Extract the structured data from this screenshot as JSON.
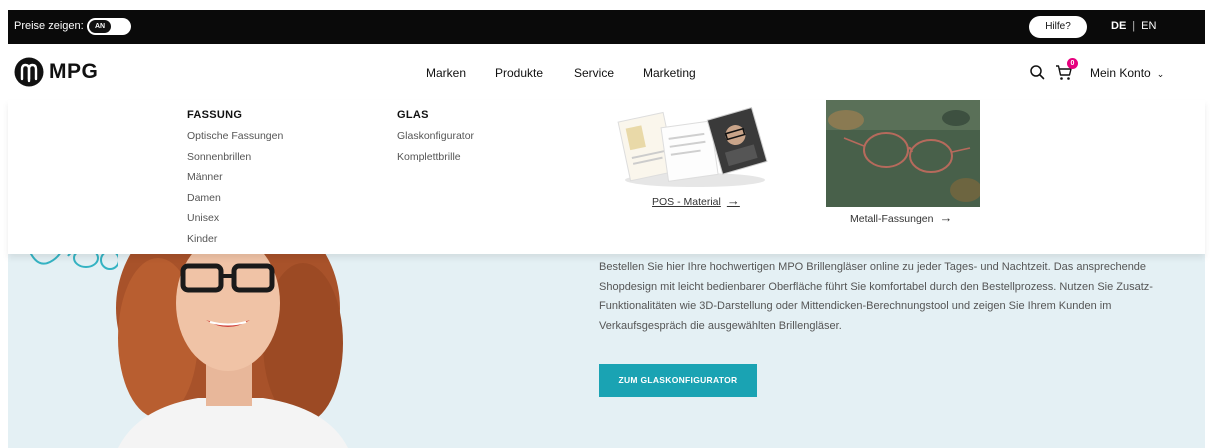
{
  "topbar": {
    "prices_label": "Preise zeigen:",
    "toggle_state": "AN",
    "help_label": "Hilfe?",
    "lang_active": "DE",
    "lang_separator": "|",
    "lang_other": "EN"
  },
  "header": {
    "logo_text": "MPG",
    "nav": [
      "Marken",
      "Produkte",
      "Service",
      "Marketing"
    ],
    "cart_count": "0",
    "account_label": "Mein Konto"
  },
  "megamenu": {
    "fassung": {
      "title": "FASSUNG",
      "items": [
        "Optische Fassungen",
        "Sonnenbrillen",
        "Männer",
        "Damen",
        "Unisex",
        "Kinder"
      ]
    },
    "glas": {
      "title": "GLAS",
      "items": [
        "Glaskonfigurator",
        "Komplettbrille"
      ]
    },
    "promos": {
      "pos_caption": "POS - Material",
      "metall_caption": "Metall-Fassungen",
      "arrow": "→"
    }
  },
  "hero": {
    "text": "Bestellen Sie hier Ihre hochwertigen MPO Brillengläser online zu jeder Tages- und Nachtzeit. Das ansprechende Shopdesign mit leicht bedienbarer Oberfläche führt Sie komfortabel durch den Bestellprozess. Nutzen Sie Zusatz-Funktionalitäten wie 3D-Darstellung oder Mittendicken-Berechnungstool und zeigen Sie Ihrem Kunden im Verkaufsgespräch die ausgewählten Brillengläser.",
    "cta_label": "ZUM GLASKONFIGURATOR"
  },
  "colors": {
    "topbar_bg": "#0a0a0a",
    "accent": "#1aa3b3",
    "badge": "#e6007e",
    "hero_bg": "#e4f0f4"
  },
  "icons": {
    "logo": "mpg-logo-icon",
    "search": "search-icon",
    "cart": "cart-icon",
    "account_chevron": "chevron-down-icon"
  }
}
